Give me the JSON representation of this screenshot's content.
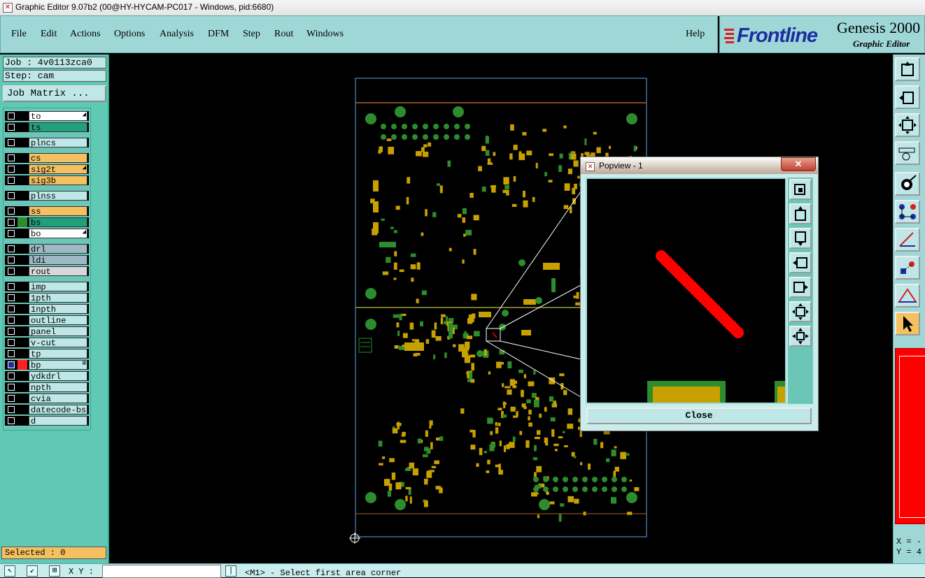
{
  "window": {
    "title": "Graphic Editor 9.07b2 (00@HY-HYCAM-PC017 - Windows, pid:6680)"
  },
  "menu": {
    "file": "File",
    "edit": "Edit",
    "actions": "Actions",
    "options": "Options",
    "analysis": "Analysis",
    "dfm": "DFM",
    "step": "Step",
    "rout": "Rout",
    "windows": "Windows",
    "help": "Help"
  },
  "brand": {
    "logo": "Frontline",
    "product": "Genesis 2000",
    "subtitle": "Graphic Editor"
  },
  "job": {
    "label": "Job : 4v0113zca0",
    "step": "Step: cam",
    "matrix_button": "Job Matrix ..."
  },
  "layers": [
    {
      "name": "to",
      "color": "#ffffff",
      "swatch": "#000000",
      "mark": "◢"
    },
    {
      "name": "ts",
      "color": "#22a07c",
      "swatch": "#000000",
      "mark": ""
    },
    {
      "name": "plncs",
      "color": "#bfe7e7",
      "swatch": "#000000",
      "mark": ""
    },
    {
      "name": "cs",
      "color": "#f5c060",
      "swatch": "#000000",
      "mark": ""
    },
    {
      "name": "sig2t",
      "color": "#f5c060",
      "swatch": "#000000",
      "mark": "◢"
    },
    {
      "name": "sig3b",
      "color": "#f5c060",
      "swatch": "#000000",
      "mark": ""
    },
    {
      "name": "plnss",
      "color": "#bfe7e7",
      "swatch": "#000000",
      "mark": ""
    },
    {
      "name": "ss",
      "color": "#f5c060",
      "swatch": "#000000",
      "mark": ""
    },
    {
      "name": "bs",
      "color": "#22a07c",
      "swatch": "#2d8c2d",
      "mark": ""
    },
    {
      "name": "bo",
      "color": "#ffffff",
      "swatch": "#000000",
      "mark": "◢"
    },
    {
      "name": "drl",
      "color": "#9fb9c4",
      "swatch": "#000000",
      "mark": ""
    },
    {
      "name": "ldi",
      "color": "#9fb9c4",
      "swatch": "#000000",
      "mark": ""
    },
    {
      "name": "rout",
      "color": "#d8d8d8",
      "swatch": "#000000",
      "mark": ""
    },
    {
      "name": "imp",
      "color": "#bfe7e7",
      "swatch": "#000000",
      "mark": ""
    },
    {
      "name": "1pth",
      "color": "#bfe7e7",
      "swatch": "#000000",
      "mark": ""
    },
    {
      "name": "1npth",
      "color": "#bfe7e7",
      "swatch": "#000000",
      "mark": ""
    },
    {
      "name": "outline",
      "color": "#bfe7e7",
      "swatch": "#000000",
      "mark": ""
    },
    {
      "name": "panel",
      "color": "#bfe7e7",
      "swatch": "#000000",
      "mark": ""
    },
    {
      "name": "v-cut",
      "color": "#bfe7e7",
      "swatch": "#000000",
      "mark": ""
    },
    {
      "name": "tp",
      "color": "#bfe7e7",
      "swatch": "#000000",
      "mark": ""
    },
    {
      "name": "bp",
      "color": "#bfe7e7",
      "swatch": "#ff2020",
      "mark": "⊞",
      "active": true
    },
    {
      "name": "ydkdrl",
      "color": "#bfe7e7",
      "swatch": "#000000",
      "mark": ""
    },
    {
      "name": "npth",
      "color": "#bfe7e7",
      "swatch": "#000000",
      "mark": ""
    },
    {
      "name": "cvia",
      "color": "#bfe7e7",
      "swatch": "#000000",
      "mark": ""
    },
    {
      "name": "datecode-bs",
      "color": "#bfe7e7",
      "swatch": "#000000",
      "mark": ""
    },
    {
      "name": "d",
      "color": "#bfe7e7",
      "swatch": "#000000",
      "mark": ""
    }
  ],
  "selected": "Selected : 0",
  "status": {
    "xy_label": "X Y :",
    "message": "<M1> - Select first area corner"
  },
  "readout": {
    "x": "X = -",
    "y": "Y = 4"
  },
  "popview": {
    "title": "Popview - 1",
    "close_button": "Close",
    "close_x": "✕"
  },
  "colors": {
    "panel": "#9fd7d7",
    "pad_yellow": "#c8a000",
    "pad_green": "#2d8c2d",
    "highlight": "#ff0000"
  }
}
